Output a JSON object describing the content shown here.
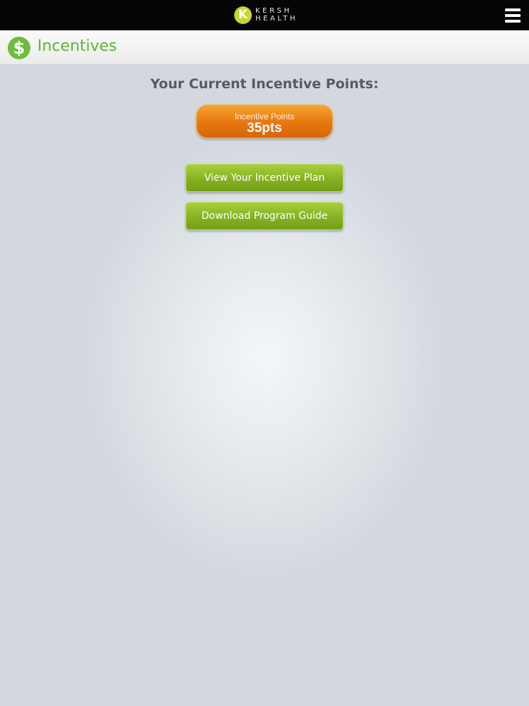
{
  "app": {
    "logo_mark": "K",
    "logo_line1": "KERSH",
    "logo_line2": "HEALTH"
  },
  "icons": {
    "menu": "hamburger-menu-icon",
    "page": "dollar-icon"
  },
  "header": {
    "dollar_symbol": "$",
    "title": "Incentives"
  },
  "main": {
    "heading": "Your Current Incentive Points:",
    "points_label": "Incentive Points",
    "points_value": "35pts",
    "buttons": [
      {
        "label": "View Your Incentive Plan"
      },
      {
        "label": "Download Program Guide"
      }
    ]
  },
  "colors": {
    "topbar": "#050505",
    "accent_green": "#5fb534",
    "points_orange": "#e7760f",
    "button_green": "#86b122"
  }
}
